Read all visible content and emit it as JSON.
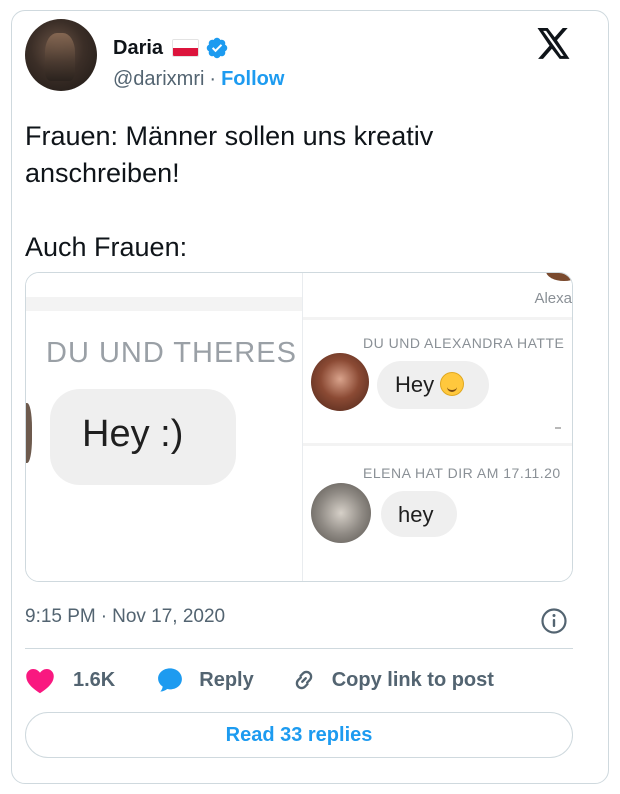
{
  "author": {
    "name": "Daria",
    "handle": "@darixmri",
    "separator": "·",
    "follow_label": "Follow"
  },
  "tweet": {
    "text": "Frauen: Männer sollen uns kreativ anschreiben!\n\nAuch Frauen:"
  },
  "media": {
    "left_panel": {
      "header": "DU UND THERES",
      "message": "Hey :)"
    },
    "right_panel": {
      "top_label": "Alexa",
      "conversation1_header": "DU UND ALEXANDRA HATTE",
      "conversation1_message": "Hey",
      "conversation2_header": "ELENA HAT DIR AM 17.11.20",
      "conversation2_message": "hey"
    }
  },
  "meta": {
    "time": "9:15 PM",
    "separator": "·",
    "date": "Nov 17, 2020"
  },
  "actions": {
    "like_count": "1.6K",
    "reply_label": "Reply",
    "copy_link_label": "Copy link to post"
  },
  "read_replies_label": "Read 33 replies",
  "colors": {
    "accent": "#1d9bf0",
    "like": "#f91880",
    "text_primary": "#0f1419",
    "text_secondary": "#536471",
    "border": "#cfd9de"
  }
}
